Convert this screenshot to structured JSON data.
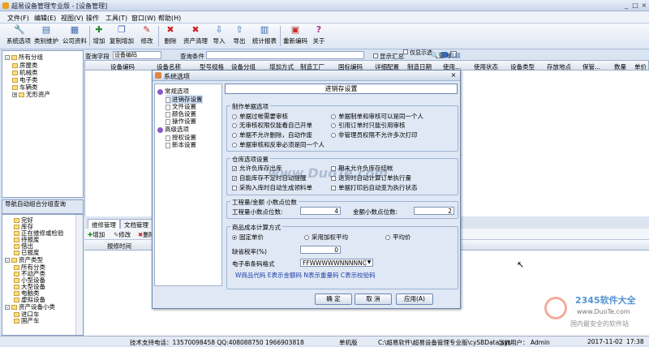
{
  "window": {
    "title": "超易设备管理专业版 - [设备管理]",
    "min": "_",
    "max": "□",
    "close": "×"
  },
  "menu": [
    "文件(F)",
    "编辑(E)",
    "视图(V)",
    "操作",
    "工具(T)",
    "窗口(W)",
    "帮助(H)"
  ],
  "toolbar": [
    {
      "label": "系统选项",
      "icon": "wrench-icon",
      "glyph": "🔧"
    },
    {
      "label": "类别维护",
      "icon": "tree-icon",
      "glyph": "▤"
    },
    {
      "label": "公司资料",
      "icon": "company-icon",
      "glyph": "▦"
    },
    {
      "label": "增加",
      "icon": "add-icon",
      "glyph": "✚"
    },
    {
      "label": "复制增加",
      "icon": "copy-icon",
      "glyph": "❐"
    },
    {
      "label": "修改",
      "icon": "edit-icon",
      "glyph": "✎"
    },
    {
      "label": "删除",
      "icon": "delete-icon",
      "glyph": "✖"
    },
    {
      "label": "资产清理",
      "icon": "clear-icon",
      "glyph": "✖"
    },
    {
      "label": "导入",
      "icon": "import-icon",
      "glyph": "⇩"
    },
    {
      "label": "导出",
      "icon": "export-icon",
      "glyph": "⇧"
    },
    {
      "label": "统计报表",
      "icon": "report-icon",
      "glyph": "▥"
    },
    {
      "label": "重新编码",
      "icon": "recode-icon",
      "glyph": "▣"
    },
    {
      "label": "关于",
      "icon": "help-icon",
      "glyph": "?"
    }
  ],
  "tree": [
    {
      "label": "所有分组",
      "level": 0,
      "pm": "-"
    },
    {
      "label": "房屋类",
      "level": 1
    },
    {
      "label": "机械类",
      "level": 1
    },
    {
      "label": "电子类",
      "level": 1
    },
    {
      "label": "车辆类",
      "level": 1
    },
    {
      "label": "无形资产",
      "level": 1,
      "pm": "+"
    }
  ],
  "nav_title": "导航自动组合分组查询",
  "tree2": [
    {
      "label": "完好",
      "level": 1
    },
    {
      "label": "库存",
      "level": 1
    },
    {
      "label": "正在维修或检验",
      "level": 1
    },
    {
      "label": "待报废",
      "level": 1
    },
    {
      "label": "借出",
      "level": 1
    },
    {
      "label": "已报废",
      "level": 1
    },
    {
      "label": "资产类型",
      "level": 0,
      "pm": "-"
    },
    {
      "label": "所有分类",
      "level": 1
    },
    {
      "label": "不动产类",
      "level": 1
    },
    {
      "label": "小型设备",
      "level": 1
    },
    {
      "label": "大型设备",
      "level": 1
    },
    {
      "label": "电脑类",
      "level": 1
    },
    {
      "label": "虚拟设备",
      "level": 1
    },
    {
      "label": "资产设备小类",
      "level": 0,
      "pm": "-"
    },
    {
      "label": "进口车",
      "level": 1
    },
    {
      "label": "国产车",
      "level": 1
    }
  ],
  "filter": {
    "field_label": "查询字段",
    "field_value": "设备编码",
    "cond_label": "查询条件",
    "show": "显示汇总",
    "only_show": "仅显示选",
    "query": "查询",
    "advanced": "高级"
  },
  "grid_headers": [
    "设备编码",
    "设备名称",
    "型号规格",
    "设备分组",
    "增加方式",
    "制造工厂",
    "国标编码",
    "详细配置",
    "制造日期",
    "使用...",
    "使用状态",
    "设备类型",
    "存放地点",
    "保管...",
    "数量",
    "单价"
  ],
  "tabs": [
    "维修管理",
    "文档管理",
    "保"
  ],
  "subtoolbar": [
    "增加",
    "修改",
    "删除"
  ],
  "subgrid_headers": [
    "报修时间"
  ],
  "status": {
    "support": "技术支持电话：13570098458 QQ:408088750 1966903818",
    "version": "单机版",
    "path": "C:\\超易软件\\超易设备管理专业版\\cySBData.sys",
    "user": "当前用户： Admin",
    "date": "2017-11-02",
    "time": "17:38"
  },
  "dialog": {
    "title": "系统选项",
    "close": "×",
    "panel_title": "进销存设置",
    "tree": [
      {
        "label": "常规选项",
        "type": "ball",
        "level": 0
      },
      {
        "label": "进销存设置",
        "type": "page",
        "level": 1
      },
      {
        "label": "文件设置",
        "type": "page",
        "level": 1
      },
      {
        "label": "颜色设置",
        "type": "page",
        "level": 1
      },
      {
        "label": "操作设置",
        "type": "page",
        "level": 1
      },
      {
        "label": "高级选项",
        "type": "ball",
        "level": 0
      },
      {
        "label": "授权设置",
        "type": "page",
        "level": 1
      },
      {
        "label": "新本设置",
        "type": "page",
        "level": 1
      }
    ],
    "group1": {
      "title": "制作单据选项",
      "options": [
        {
          "label": "单据过帐需要审核",
          "checked": false
        },
        {
          "label": "单据制单和审核可以是同一个人",
          "checked": false
        },
        {
          "label": "无审核权限仅能看自己开单",
          "checked": false
        },
        {
          "label": "引用订单时只能引用审核",
          "checked": false
        },
        {
          "label": "单据不允许删除，自动作废",
          "checked": false
        },
        {
          "label": "非管理员权限不允许多次打印",
          "checked": false
        },
        {
          "label": "单据审核和反审必须是同一个人",
          "checked": false
        }
      ]
    },
    "group2": {
      "title": "仓库选项设置",
      "options": [
        {
          "label": "允许负库存出库",
          "checked": true
        },
        {
          "label": "期末允许负库存结帐",
          "checked": false
        },
        {
          "label": "自能库存不足时自动提醒",
          "checked": true
        },
        {
          "label": "退货时自动计算订单执行量",
          "checked": false
        },
        {
          "label": "采购入库时自动生成领料单",
          "checked": false
        },
        {
          "label": "单据打印后自动变为执行状态",
          "checked": false
        }
      ]
    },
    "group3": {
      "title": "工程量/金额 小数点位数",
      "qty_label": "工程量小数点位数:",
      "qty_value": "4",
      "amt_label": "金额小数点位数:",
      "amt_value": "2"
    },
    "group4": {
      "title": "商品成本计算方式",
      "options": [
        {
          "label": "固定单价",
          "checked": true
        },
        {
          "label": "采用加权平均",
          "checked": false
        },
        {
          "label": "平均价",
          "checked": false
        }
      ],
      "tax_label": "缺省税率(%)",
      "tax_value": "0",
      "code_label": "电子串条码格式",
      "code_value": "FFWWWWWNNNNNC",
      "hint": "W商品代码 E表示金额码 N表示重量码 C表示校验码"
    },
    "ok": "确 定",
    "cancel": "取 消",
    "apply": "应用(A)"
  },
  "watermark": {
    "text": "www.DuoTe.com",
    "site": "2345软件大全",
    "site_url": "www.DuoTe.com",
    "site_cn": "国内最安全的软件站"
  },
  "colors": {
    "accent": "#3a67b0",
    "title_bg": "#c9d7ec"
  }
}
